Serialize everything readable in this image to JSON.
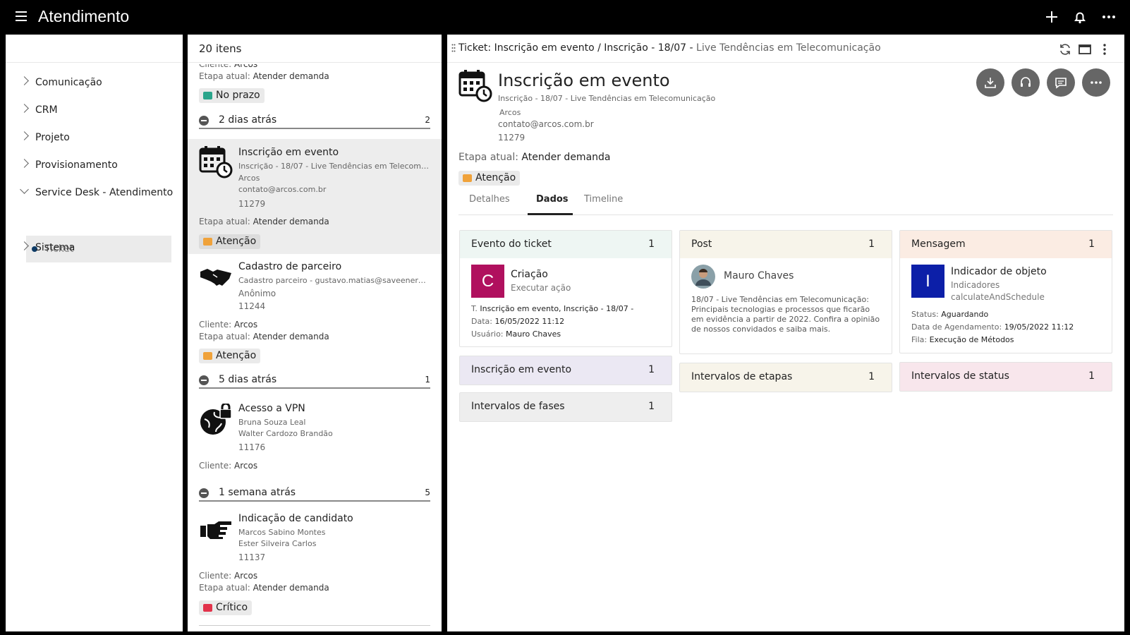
{
  "app": {
    "title": "Atendimento"
  },
  "nav": {
    "items": [
      {
        "label": "Comunicação"
      },
      {
        "label": "CRM"
      },
      {
        "label": "Projeto"
      },
      {
        "label": "Provisionamento"
      },
      {
        "label": "Service Desk - Atendimento"
      },
      {
        "label": "Sistema"
      }
    ],
    "subitem": "Ticket"
  },
  "list": {
    "count": "20 itens",
    "top": {
      "cliente_k": "Cliente:",
      "cliente_v": "Arcos",
      "etapa_k": "Etapa atual:",
      "etapa_v": "Atender demanda",
      "badge": "No prazo"
    },
    "groups": [
      {
        "label": "2 dias atrás",
        "count": "2"
      },
      {
        "label": "5 dias atrás",
        "count": "1"
      },
      {
        "label": "1 semana atrás",
        "count": "5"
      }
    ],
    "items": [
      {
        "title": "Inscrição em evento",
        "sub": "Inscrição - 18/07 - Live Tendências em Telecomunicação",
        "l2": "Arcos",
        "l3": "contato@arcos.com.br",
        "id": "11279",
        "etapa_k": "Etapa atual:",
        "etapa_v": "Atender demanda",
        "badge": "Atenção"
      },
      {
        "title": "Cadastro de parceiro",
        "sub": "Cadastro parceiro - gustavo.matias@saveenergy.com.br",
        "l2": "Anônimo",
        "id": "11244",
        "cliente_k": "Cliente:",
        "cliente_v": "Arcos",
        "etapa_k": "Etapa atual:",
        "etapa_v": "Atender demanda",
        "badge": "Atenção"
      },
      {
        "title": "Acesso a VPN",
        "l1": "Bruna Souza Leal",
        "l2": "Walter Cardozo Brandão",
        "id": "11176",
        "cliente_k": "Cliente:",
        "cliente_v": "Arcos"
      },
      {
        "title": "Indicação de candidato",
        "l1": "Marcos Sabino Montes",
        "l2": "Ester Silveira Carlos",
        "id": "11137",
        "cliente_k": "Cliente:",
        "cliente_v": "Arcos",
        "etapa_k": "Etapa atual:",
        "etapa_v": "Atender demanda",
        "badge": "Crítico"
      }
    ]
  },
  "detail": {
    "header_main": "Ticket: Inscrição em evento / Inscrição - 18/07 -",
    "header_gray": "Live Tendências em Telecomunicação",
    "title": "Inscrição em evento",
    "subtitle": "Inscrição - 18/07 - Live Tendências em Telecomunicação",
    "client": "Arcos",
    "email": "contato@arcos.com.br",
    "id": "11279",
    "etapa_k": "Etapa atual:",
    "etapa_v": "Atender demanda",
    "badge": "Atenção",
    "tabs": [
      {
        "label": "Detalhes"
      },
      {
        "label": "Dados"
      },
      {
        "label": "Timeline"
      }
    ],
    "cards": {
      "evento": {
        "title": "Evento do ticket",
        "count": "1",
        "letter": "C",
        "name": "Criação",
        "action": "Executar ação",
        "t_k": "T.",
        "t_v": "Inscrição em evento, Inscrição - 18/07 -",
        "data_k": "Data:",
        "data_v": "16/05/2022 11:12",
        "user_k": "Usuário:",
        "user_v": "Mauro Chaves"
      },
      "post": {
        "title": "Post",
        "count": "1",
        "author": "Mauro Chaves",
        "text1": "18/07 - Live Tendências em Telecomunicação:",
        "text2": "Principais tecnologias e processos que ficarão",
        "text3": "em evidência a partir de 2022. Confira a opinião",
        "text4": "de nossos convidados e saiba mais."
      },
      "mensagem": {
        "title": "Mensagem",
        "count": "1",
        "letter": "I",
        "name": "Indicador de objeto",
        "cat": "Indicadores",
        "method": "calculateAndSchedule",
        "status_k": "Status:",
        "status_v": "Aguardando",
        "ag_k": "Data de Agendamento:",
        "ag_v": "19/05/2022 11:12",
        "fila_k": "Fila:",
        "fila_v": "Execução de Métodos"
      },
      "inscricao": {
        "title": "Inscrição em evento",
        "count": "1"
      },
      "fases": {
        "title": "Intervalos de fases",
        "count": "1"
      },
      "etapas": {
        "title": "Intervalos de etapas",
        "count": "1"
      },
      "status": {
        "title": "Intervalos de status",
        "count": "1"
      }
    }
  },
  "colors": {
    "topbar": "#000000",
    "badge_ok": "#2aa58b",
    "badge_warn": "#f0a23a",
    "badge_crit": "#e2334b",
    "creation": "#b0105e",
    "indicator": "#0c1fa8"
  }
}
